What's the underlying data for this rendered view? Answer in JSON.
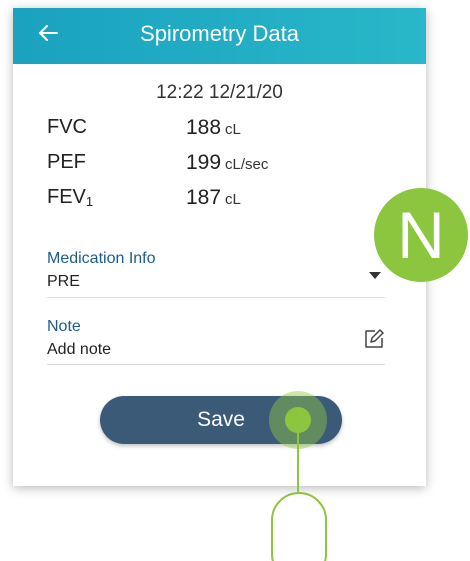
{
  "header": {
    "title": "Spirometry Data",
    "back_icon": "arrow-left-icon"
  },
  "timestamp": "12:22 12/21/20",
  "metrics": [
    {
      "name": "FVC",
      "value": "188",
      "unit": "cL"
    },
    {
      "name": "PEF",
      "value": "199",
      "unit": "cL/sec"
    },
    {
      "name": "FEV",
      "name_sub": "1",
      "value": "187",
      "unit": "cL"
    }
  ],
  "medication": {
    "label": "Medication Info",
    "value": "PRE",
    "icon": "dropdown-arrow-icon"
  },
  "note": {
    "label": "Note",
    "value": "Add note",
    "icon": "edit-icon"
  },
  "save_label": "Save",
  "annotations": {
    "badge_n": "N",
    "badge_o": "",
    "accent_color": "#8cc63f"
  },
  "colors": {
    "header": "#1aa2bf",
    "save_button": "#3a5a78",
    "label": "#1d5b8f"
  }
}
